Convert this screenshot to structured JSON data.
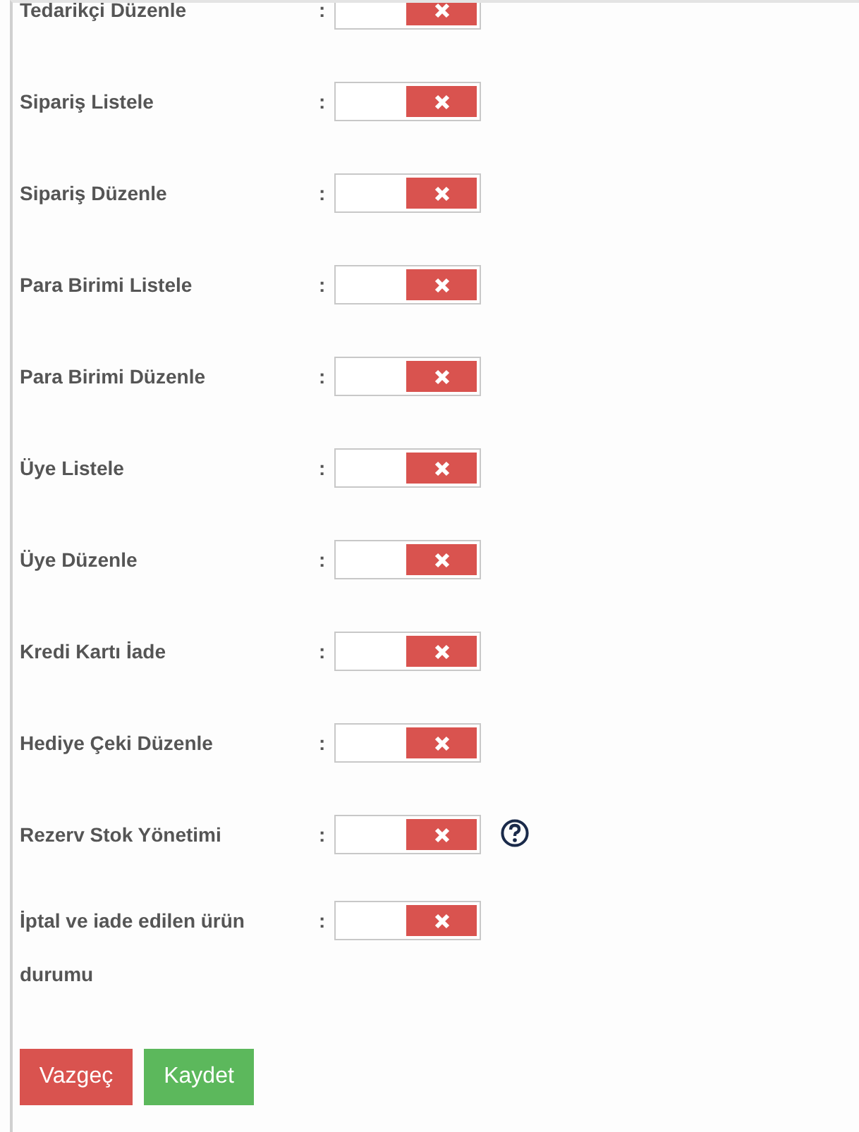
{
  "permissions": [
    {
      "label": "Tedarikçi Düzenle",
      "on": false,
      "help": false
    },
    {
      "label": "Sipariş Listele",
      "on": false,
      "help": false
    },
    {
      "label": "Sipariş Düzenle",
      "on": false,
      "help": false
    },
    {
      "label": "Para Birimi Listele",
      "on": false,
      "help": false
    },
    {
      "label": "Para Birimi Düzenle",
      "on": false,
      "help": false
    },
    {
      "label": "Üye Listele",
      "on": false,
      "help": false
    },
    {
      "label": "Üye Düzenle",
      "on": false,
      "help": false
    },
    {
      "label": "Kredi Kartı İade",
      "on": false,
      "help": false
    },
    {
      "label": "Hediye Çeki Düzenle",
      "on": false,
      "help": false
    },
    {
      "label": "Rezerv Stok Yönetimi",
      "on": false,
      "help": true
    },
    {
      "label": "İptal ve iade edilen ürün durumu",
      "on": false,
      "help": false
    }
  ],
  "separator": ":",
  "buttons": [
    {
      "label": "Vazgeç",
      "kind": "cancel"
    },
    {
      "label": "Kaydet",
      "kind": "save"
    }
  ]
}
